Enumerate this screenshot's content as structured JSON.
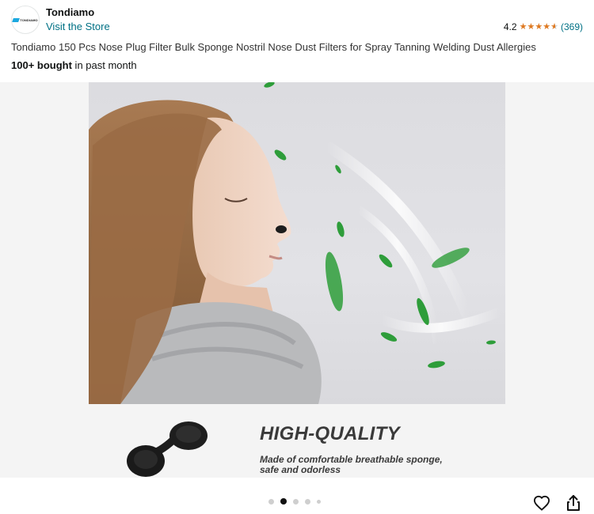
{
  "store": {
    "logo_text": "TONDIAMO",
    "brand_name": "Tondiamo",
    "visit_link": "Visit the Store"
  },
  "rating": {
    "value": "4.2",
    "stars": 4.2,
    "count": "(369)"
  },
  "product": {
    "title": "Tondiamo 150 Pcs Nose Plug Filter Bulk Sponge Nostril Nose Dust Filters for Spray Tanning Welding Dust Allergies",
    "bought_bold": "100+ bought",
    "bought_rest": " in past month"
  },
  "gallery": {
    "headline": "HIGH-QUALITY",
    "subtext_line1": "Made of comfortable breathable sponge,",
    "subtext_line2": "safe and odorless",
    "slide_count": 5,
    "active_slide": 2
  },
  "icons": [
    "logo-icon",
    "star-icon",
    "heart-icon",
    "share-icon"
  ],
  "colors": {
    "link": "#007185",
    "star": "#de7921",
    "leaf": "#2e9d3a"
  }
}
